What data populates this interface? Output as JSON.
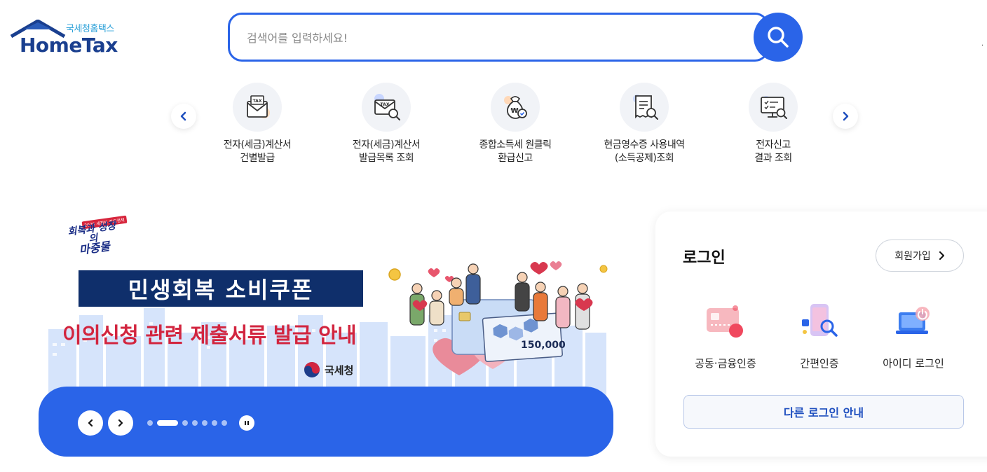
{
  "logo": {
    "sub_text": "국세청홈택스",
    "main_text": "HomeTax"
  },
  "search": {
    "placeholder": "검색어를 입력하세요!",
    "value": ""
  },
  "quick_menu": {
    "items": [
      {
        "line1": "전자(세금)계산서",
        "line2": "건별발급",
        "icon": "tax-envelope-icon"
      },
      {
        "line1": "전자(세금)계산서",
        "line2": "발급목록 조회",
        "icon": "tax-envelope-search-icon"
      },
      {
        "line1": "종합소득세 원클릭",
        "line2": "환급신고",
        "icon": "money-bag-icon"
      },
      {
        "line1": "현금영수증 사용내역",
        "line2": "(소득공제)조회",
        "icon": "receipt-search-icon"
      },
      {
        "line1": "전자신고",
        "line2": "결과 조회",
        "icon": "monitor-search-icon"
      }
    ]
  },
  "banner": {
    "badge_tiny": "2025 새정부 주요정책",
    "badge_line1": "회복과 성장의",
    "badge_line2": "마중물",
    "headline": "민생회복 소비쿠폰",
    "subline": "이의신청 관련 제출서류 발급 안내",
    "org": "국세청",
    "coupon_amount": "150,000",
    "slide_count": 7,
    "active_slide": 1
  },
  "login": {
    "title": "로그인",
    "signup_label": "회원가입",
    "options": [
      {
        "label": "공동·금융인증",
        "icon": "certificate-card-icon"
      },
      {
        "label": "간편인증",
        "icon": "phone-search-icon"
      },
      {
        "label": "아이디 로그인",
        "icon": "laptop-power-icon"
      }
    ],
    "other_label": "다른 로그인 안내"
  },
  "colors": {
    "primary": "#2a64e8",
    "navy": "#0f2f6b",
    "red": "#d2253f"
  }
}
